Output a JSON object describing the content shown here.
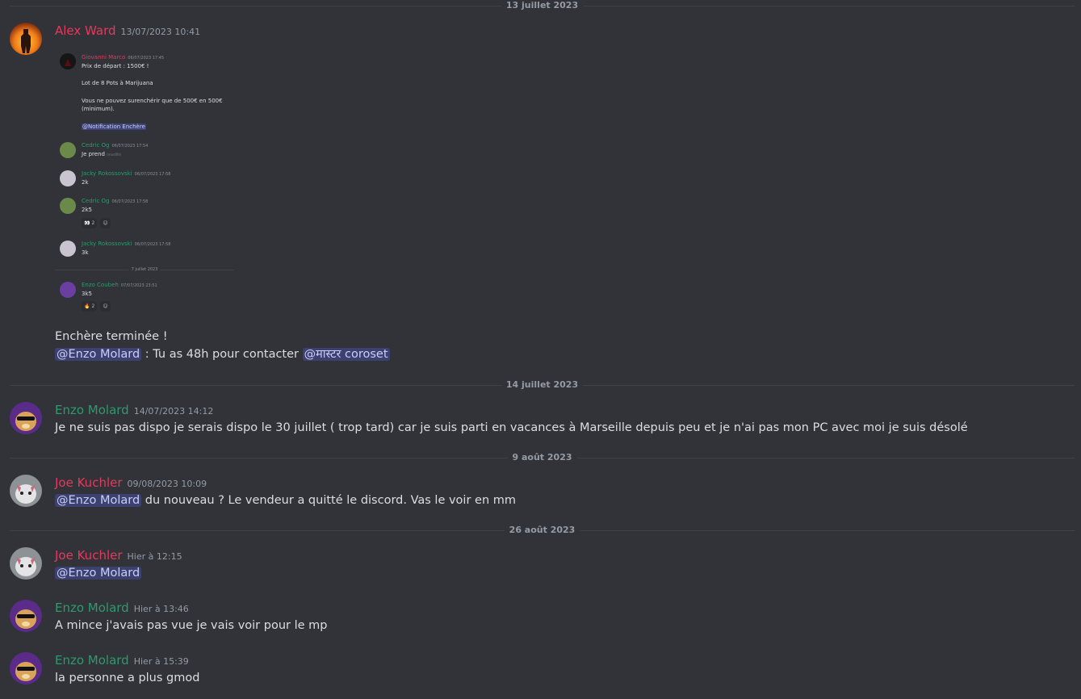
{
  "dividers": {
    "d1": "13 juillet 2023",
    "d2": "14 juillet 2023",
    "d3": "9 août 2023",
    "d4": "26 août 2023"
  },
  "colors": {
    "background": "#313338",
    "pink_name": "#e8385d",
    "green_name": "#2e9a6c",
    "mention_bg": "#5865f2"
  },
  "messages": {
    "m1": {
      "author": "Alex Ward",
      "timestamp": "13/07/2023 10:41",
      "line1": "Enchère terminée !",
      "mention1": "@Enzo Molard",
      "text2": " : Tu as 48h pour contacter ",
      "mention2": "@मास्टर coroset"
    },
    "m2": {
      "author": "Enzo Molard",
      "timestamp": "14/07/2023 14:12",
      "text": "Je ne suis pas dispo je serais dispo le 30 juillet ( trop tard) car je suis parti en vacances à Marseille depuis peu et je n'ai pas mon PC avec moi je suis désolé"
    },
    "m3": {
      "author": "Joe Kuchler",
      "timestamp": "09/08/2023 10:09",
      "mention": "@Enzo Molard",
      "text": " du nouveau ? Le vendeur a quitté le discord. Vas le voir en mm"
    },
    "m4": {
      "author": "Joe Kuchler",
      "timestamp": "Hier à 12:15",
      "mention": "@Enzo Molard"
    },
    "m5": {
      "author": "Enzo Molard",
      "timestamp": "Hier à 13:46",
      "text": "A mince j'avais pas vue je vais voir pour le mp"
    },
    "m6": {
      "author": "Enzo Molard",
      "timestamp": "Hier à 15:39",
      "text": "la personne a plus gmod"
    }
  },
  "embed": {
    "e1": {
      "author": "Giovanni Marco",
      "timestamp": "06/07/2023 17:45",
      "l1": "Prix de départ : 1500€ !",
      "l2": "Lot de 8 Pots à Marijuana",
      "l3": "Vous ne pouvez surenchérir que de 500€ en 500€",
      "l4": "(minimum).",
      "mention": "@Notification Enchère"
    },
    "e2": {
      "author": "Cedric Og",
      "timestamp": "06/07/2023 17:54",
      "text": "Je prend",
      "edited": "(modifié)"
    },
    "e3": {
      "author": "Jacky Rokossovski",
      "timestamp": "06/07/2023 17:58",
      "text": "2k"
    },
    "e4": {
      "author": "Cedric Og",
      "timestamp": "06/07/2023 17:58",
      "text": "2k5",
      "react_count": "2"
    },
    "e5": {
      "author": "Jacky Rokossovski",
      "timestamp": "06/07/2023 17:58",
      "text": "3k"
    },
    "divider": "7 juillet 2023",
    "e6": {
      "author": "Enzo Coubeh",
      "timestamp": "07/07/2023 23:51",
      "text": "3k5",
      "react_count": "2"
    }
  },
  "icons": [
    "eyes-emoji-icon",
    "fire-emoji-icon",
    "add-reaction-icon"
  ]
}
